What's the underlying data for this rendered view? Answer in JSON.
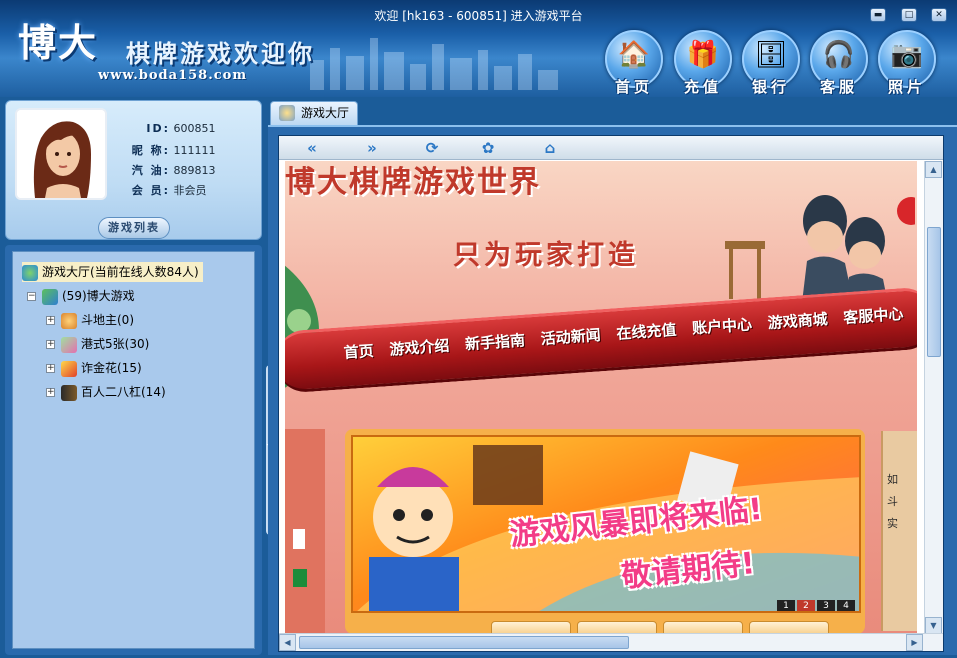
{
  "window": {
    "title": "欢迎 [hk163 - 600851] 进入游戏平台",
    "controls": [
      "minimize",
      "maximize",
      "close"
    ]
  },
  "brand": {
    "logo_main": "博大",
    "logo_sub": "棋牌游戏欢迎你",
    "url": "www.boda158.com"
  },
  "nav": [
    {
      "label": "首页",
      "icon": "home-icon"
    },
    {
      "label": "充值",
      "icon": "recharge-icon"
    },
    {
      "label": "银行",
      "icon": "bank-icon"
    },
    {
      "label": "客服",
      "icon": "support-icon"
    },
    {
      "label": "照片",
      "icon": "camera-icon"
    }
  ],
  "profile": {
    "id_label": "ID:",
    "id": "600851",
    "nick_label": "昵 称:",
    "nick": "111111",
    "gas_label": "汽 油:",
    "gas": "889813",
    "member_label": "会 员:",
    "member": "非会员",
    "game_list_button": "游戏列表"
  },
  "tree": {
    "root": "游戏大厅(当前在线人数84人)",
    "group": "(59)博大游戏",
    "items": [
      {
        "label": "斗地主(0)",
        "icon": "landlord-icon"
      },
      {
        "label": "港式5张(30)",
        "icon": "poker-icon"
      },
      {
        "label": "诈金花(15)",
        "icon": "golden-flower-icon"
      },
      {
        "label": "百人二八杠(14)",
        "icon": "mahjong-icon"
      }
    ]
  },
  "tab": {
    "label": "游戏大厅"
  },
  "browser_toolbar": [
    "back-icon",
    "forward-icon",
    "refresh-icon",
    "stop-icon",
    "home-icon"
  ],
  "webpage": {
    "title": "博大棋牌游戏世界",
    "slogan": "只为玩家打造",
    "menu": [
      "首页",
      "游戏介绍",
      "新手指南",
      "活动新闻",
      "在线充值",
      "账户中心",
      "游戏商城",
      "客服中心"
    ],
    "promo_line1": "游戏风暴即将来临!",
    "promo_line2": "敬请期待!",
    "pager": [
      "1",
      "2",
      "3",
      "4"
    ],
    "side_items": [
      "如",
      "斗",
      "实"
    ]
  }
}
